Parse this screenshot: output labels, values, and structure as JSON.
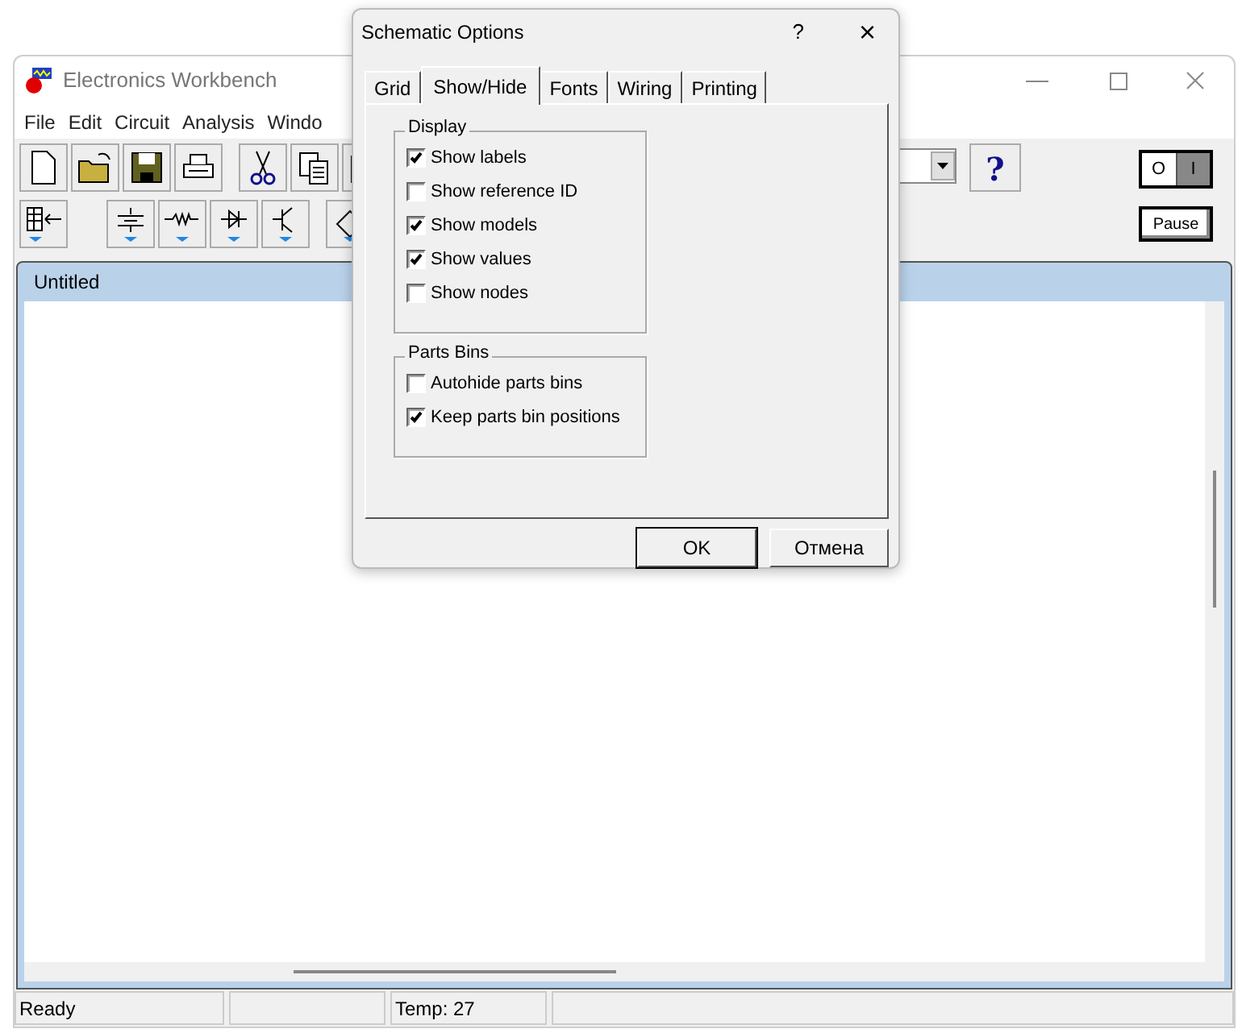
{
  "main_window": {
    "title": "Electronics Workbench",
    "menu": [
      "File",
      "Edit",
      "Circuit",
      "Analysis",
      "Windo"
    ],
    "pause_button": "Pause",
    "power_switch": {
      "on_label": "O",
      "off_label": "I",
      "on": true
    },
    "help_button": "?"
  },
  "document": {
    "title": "Untitled"
  },
  "status_bar": [
    "Ready",
    "Temp:  27"
  ],
  "dialog": {
    "title": "Schematic Options",
    "help": "?",
    "close": "×",
    "tabs": [
      {
        "label": "Grid",
        "selected": false
      },
      {
        "label": "Show/Hide",
        "selected": true
      },
      {
        "label": "Fonts",
        "selected": false
      },
      {
        "label": "Wiring",
        "selected": false
      },
      {
        "label": "Printing",
        "selected": false
      }
    ],
    "groups": [
      {
        "title": "Display",
        "items": [
          {
            "label": "Show labels",
            "checked": true
          },
          {
            "label": "Show reference ID",
            "checked": false
          },
          {
            "label": "Show models",
            "checked": true
          },
          {
            "label": "Show values",
            "checked": true
          },
          {
            "label": "Show nodes",
            "checked": false
          }
        ]
      },
      {
        "title": "Parts Bins",
        "items": [
          {
            "label": "Autohide parts bins",
            "checked": false
          },
          {
            "label": "Keep parts bin positions",
            "checked": true
          }
        ]
      }
    ],
    "buttons": [
      "OK",
      "Отмена"
    ]
  }
}
